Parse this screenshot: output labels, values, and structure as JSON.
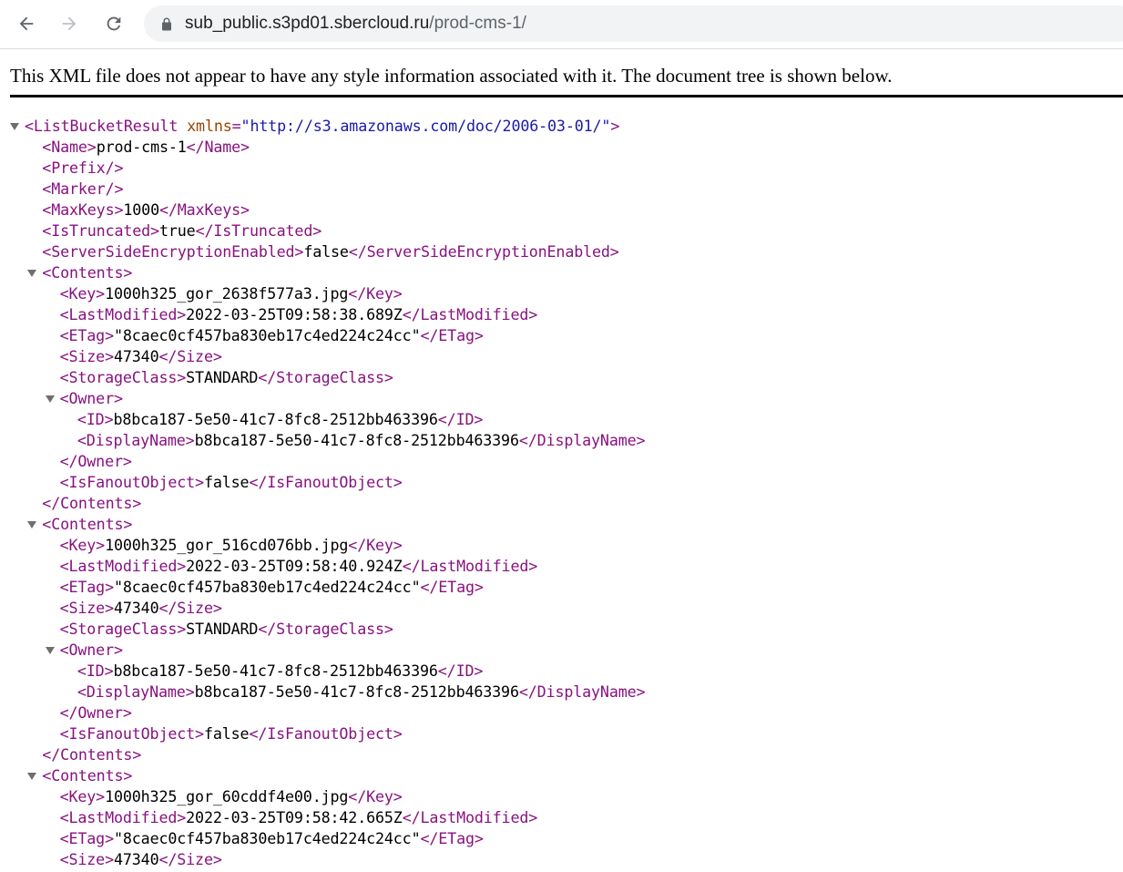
{
  "browser": {
    "url_host": "sub_public.s3pd01.sbercloud.ru",
    "url_path": "/prod-cms-1/",
    "icons": {
      "back": "back-arrow-icon",
      "forward": "forward-arrow-icon",
      "reload": "reload-icon",
      "lock": "lock-icon"
    }
  },
  "info_text": "This XML file does not appear to have any style information associated with it. The document tree is shown below.",
  "colors": {
    "tag": "#881280",
    "attr_name": "#994500",
    "attr_value": "#1a1aa6",
    "text": "#000000"
  },
  "xml": {
    "root_open": "<ListBucketResult",
    "root_attr_name": "xmlns",
    "root_attr_eq": "=",
    "root_attr_value": "\"http://s3.amazonaws.com/doc/2006-03-01/\"",
    "root_open_end": ">",
    "header_lines": [
      {
        "open": "<Name>",
        "value": "prod-cms-1",
        "close": "</Name>"
      },
      {
        "open": "<Prefix/>",
        "value": "",
        "close": ""
      },
      {
        "open": "<Marker/>",
        "value": "",
        "close": ""
      },
      {
        "open": "<MaxKeys>",
        "value": "1000",
        "close": "</MaxKeys>"
      },
      {
        "open": "<IsTruncated>",
        "value": "true",
        "close": "</IsTruncated>"
      },
      {
        "open": "<ServerSideEncryptionEnabled>",
        "value": "false",
        "close": "</ServerSideEncryptionEnabled>"
      }
    ],
    "contents": [
      {
        "open": "<Contents>",
        "close": "</Contents>",
        "fields": [
          {
            "open": "<Key>",
            "value": "1000h325_gor_2638f577a3.jpg",
            "close": "</Key>"
          },
          {
            "open": "<LastModified>",
            "value": "2022-03-25T09:58:38.689Z",
            "close": "</LastModified>"
          },
          {
            "open": "<ETag>",
            "value": "\"8caec0cf457ba830eb17c4ed224c24cc\"",
            "close": "</ETag>"
          },
          {
            "open": "<Size>",
            "value": "47340",
            "close": "</Size>"
          },
          {
            "open": "<StorageClass>",
            "value": "STANDARD",
            "close": "</StorageClass>"
          }
        ],
        "owner": {
          "open": "<Owner>",
          "close": "</Owner>",
          "fields": [
            {
              "open": "<ID>",
              "value": "b8bca187-5e50-41c7-8fc8-2512bb463396",
              "close": "</ID>"
            },
            {
              "open": "<DisplayName>",
              "value": "b8bca187-5e50-41c7-8fc8-2512bb463396",
              "close": "</DisplayName>"
            }
          ]
        },
        "fanout": {
          "open": "<IsFanoutObject>",
          "value": "false",
          "close": "</IsFanoutObject>"
        }
      },
      {
        "open": "<Contents>",
        "close": "</Contents>",
        "fields": [
          {
            "open": "<Key>",
            "value": "1000h325_gor_516cd076bb.jpg",
            "close": "</Key>"
          },
          {
            "open": "<LastModified>",
            "value": "2022-03-25T09:58:40.924Z",
            "close": "</LastModified>"
          },
          {
            "open": "<ETag>",
            "value": "\"8caec0cf457ba830eb17c4ed224c24cc\"",
            "close": "</ETag>"
          },
          {
            "open": "<Size>",
            "value": "47340",
            "close": "</Size>"
          },
          {
            "open": "<StorageClass>",
            "value": "STANDARD",
            "close": "</StorageClass>"
          }
        ],
        "owner": {
          "open": "<Owner>",
          "close": "</Owner>",
          "fields": [
            {
              "open": "<ID>",
              "value": "b8bca187-5e50-41c7-8fc8-2512bb463396",
              "close": "</ID>"
            },
            {
              "open": "<DisplayName>",
              "value": "b8bca187-5e50-41c7-8fc8-2512bb463396",
              "close": "</DisplayName>"
            }
          ]
        },
        "fanout": {
          "open": "<IsFanoutObject>",
          "value": "false",
          "close": "</IsFanoutObject>"
        }
      },
      {
        "open": "<Contents>",
        "close": "</Contents>",
        "fields": [
          {
            "open": "<Key>",
            "value": "1000h325_gor_60cddf4e00.jpg",
            "close": "</Key>"
          },
          {
            "open": "<LastModified>",
            "value": "2022-03-25T09:58:42.665Z",
            "close": "</LastModified>"
          },
          {
            "open": "<ETag>",
            "value": "\"8caec0cf457ba830eb17c4ed224c24cc\"",
            "close": "</ETag>"
          },
          {
            "open": "<Size>",
            "value": "47340",
            "close": "</Size>"
          }
        ]
      }
    ]
  }
}
